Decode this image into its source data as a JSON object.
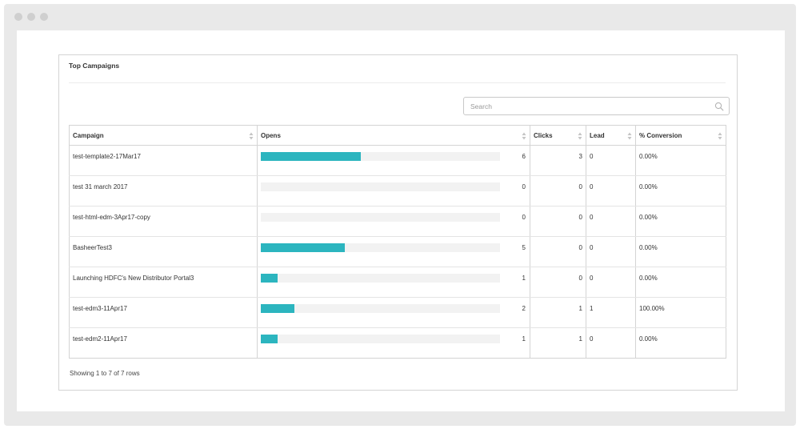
{
  "panel": {
    "title": "Top Campaigns"
  },
  "search": {
    "placeholder": "Search",
    "icon": "search-icon"
  },
  "table": {
    "columns": [
      "Campaign",
      "Opens",
      "Clicks",
      "Lead",
      "% Conversion"
    ],
    "opens_max": 14.3,
    "rows": [
      {
        "campaign": "test-template2-17Mar17",
        "opens": "6",
        "clicks": "3",
        "lead": "0",
        "conversion": "0.00%"
      },
      {
        "campaign": "test 31 march 2017",
        "opens": "0",
        "clicks": "0",
        "lead": "0",
        "conversion": "0.00%"
      },
      {
        "campaign": "test-html-edm-3Apr17-copy",
        "opens": "0",
        "clicks": "0",
        "lead": "0",
        "conversion": "0.00%"
      },
      {
        "campaign": "BasheerTest3",
        "opens": "5",
        "clicks": "0",
        "lead": "0",
        "conversion": "0.00%"
      },
      {
        "campaign": "Launching HDFC's New Distributor Portal3",
        "opens": "1",
        "clicks": "0",
        "lead": "0",
        "conversion": "0.00%"
      },
      {
        "campaign": "test-edm3-11Apr17",
        "opens": "2",
        "clicks": "1",
        "lead": "1",
        "conversion": "100.00%"
      },
      {
        "campaign": "test-edm2-11Apr17",
        "opens": "1",
        "clicks": "1",
        "lead": "0",
        "conversion": "0.00%"
      }
    ]
  },
  "footer": {
    "text": "Showing 1 to 7 of 7 rows"
  },
  "colors": {
    "bar": "#2cb5bf",
    "track": "#f2f2f2",
    "chrome": "#e9e9e9"
  }
}
